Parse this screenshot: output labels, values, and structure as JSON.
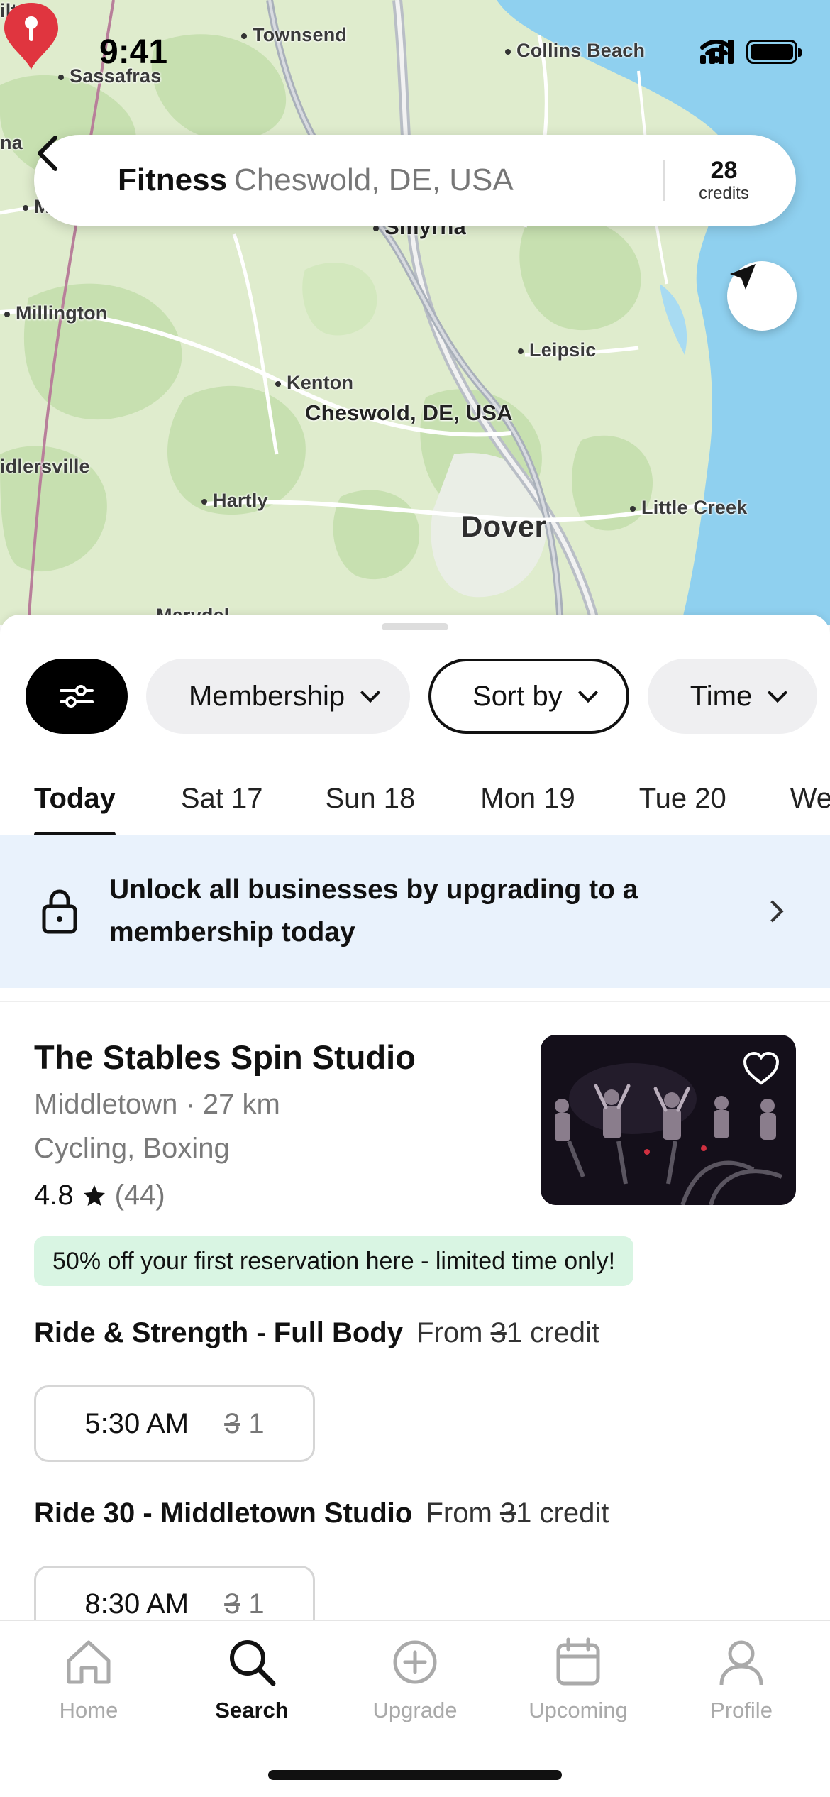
{
  "status_bar": {
    "time": "9:41"
  },
  "map": {
    "places": [
      "Townsend",
      "Sassafras",
      "Collins Beach",
      "Smyrna",
      "Millington",
      "Leipsic",
      "Kenton",
      "Cheswold, DE, USA",
      "Hartly",
      "Dover",
      "Little Creek",
      "Marydel"
    ],
    "partial_labels": [
      "ilton",
      "na",
      "M",
      "idlersville"
    ],
    "pin_label": "Cheswold, DE, USA",
    "colors": {
      "land": "#dfeccd",
      "forest": "#c7e0b0",
      "water": "#8fd0ef",
      "road": "#b9bec6",
      "pin": "#e0353f"
    }
  },
  "search": {
    "category": "Fitness",
    "location": "Cheswold, DE, USA",
    "credits_count": "28",
    "credits_label": "credits",
    "back_icon": "back-chevron-icon",
    "locate_icon": "location-arrow-icon"
  },
  "filters": {
    "filter_icon": "filter-sliders-icon",
    "chips": [
      "Membership",
      "Sort by",
      "Time"
    ]
  },
  "date_tabs": [
    "Today",
    "Sat 17",
    "Sun 18",
    "Mon 19",
    "Tue 20",
    "We"
  ],
  "banner": {
    "text_line1": "Unlock all businesses by upgrading to a",
    "text_line2": "membership today"
  },
  "studio": {
    "name": "The Stables Spin Studio",
    "meta": "Middletown · 27 km",
    "tags": "Cycling, Boxing",
    "rating": "4.8",
    "reviews": "(44)",
    "promo": "50% off your first reservation here - limited time only!",
    "classes": [
      {
        "name": "Ride & Strength - Full Body",
        "from": "From",
        "old": "3",
        "new": "1 credit",
        "time": "5:30 AM",
        "slot_old": "3",
        "slot_new": "1"
      },
      {
        "name": "Ride 30 - Middletown Studio",
        "from": "From",
        "old": "3",
        "new": "1 credit",
        "time": "8:30 AM",
        "slot_old": "3",
        "slot_new": "1"
      }
    ]
  },
  "tab_bar": {
    "tabs": [
      {
        "label": "Home",
        "icon": "home-icon"
      },
      {
        "label": "Search",
        "icon": "search-icon"
      },
      {
        "label": "Upgrade",
        "icon": "plus-circle-icon"
      },
      {
        "label": "Upcoming",
        "icon": "calendar-icon"
      },
      {
        "label": "Profile",
        "icon": "profile-icon"
      }
    ],
    "active": "Search"
  }
}
